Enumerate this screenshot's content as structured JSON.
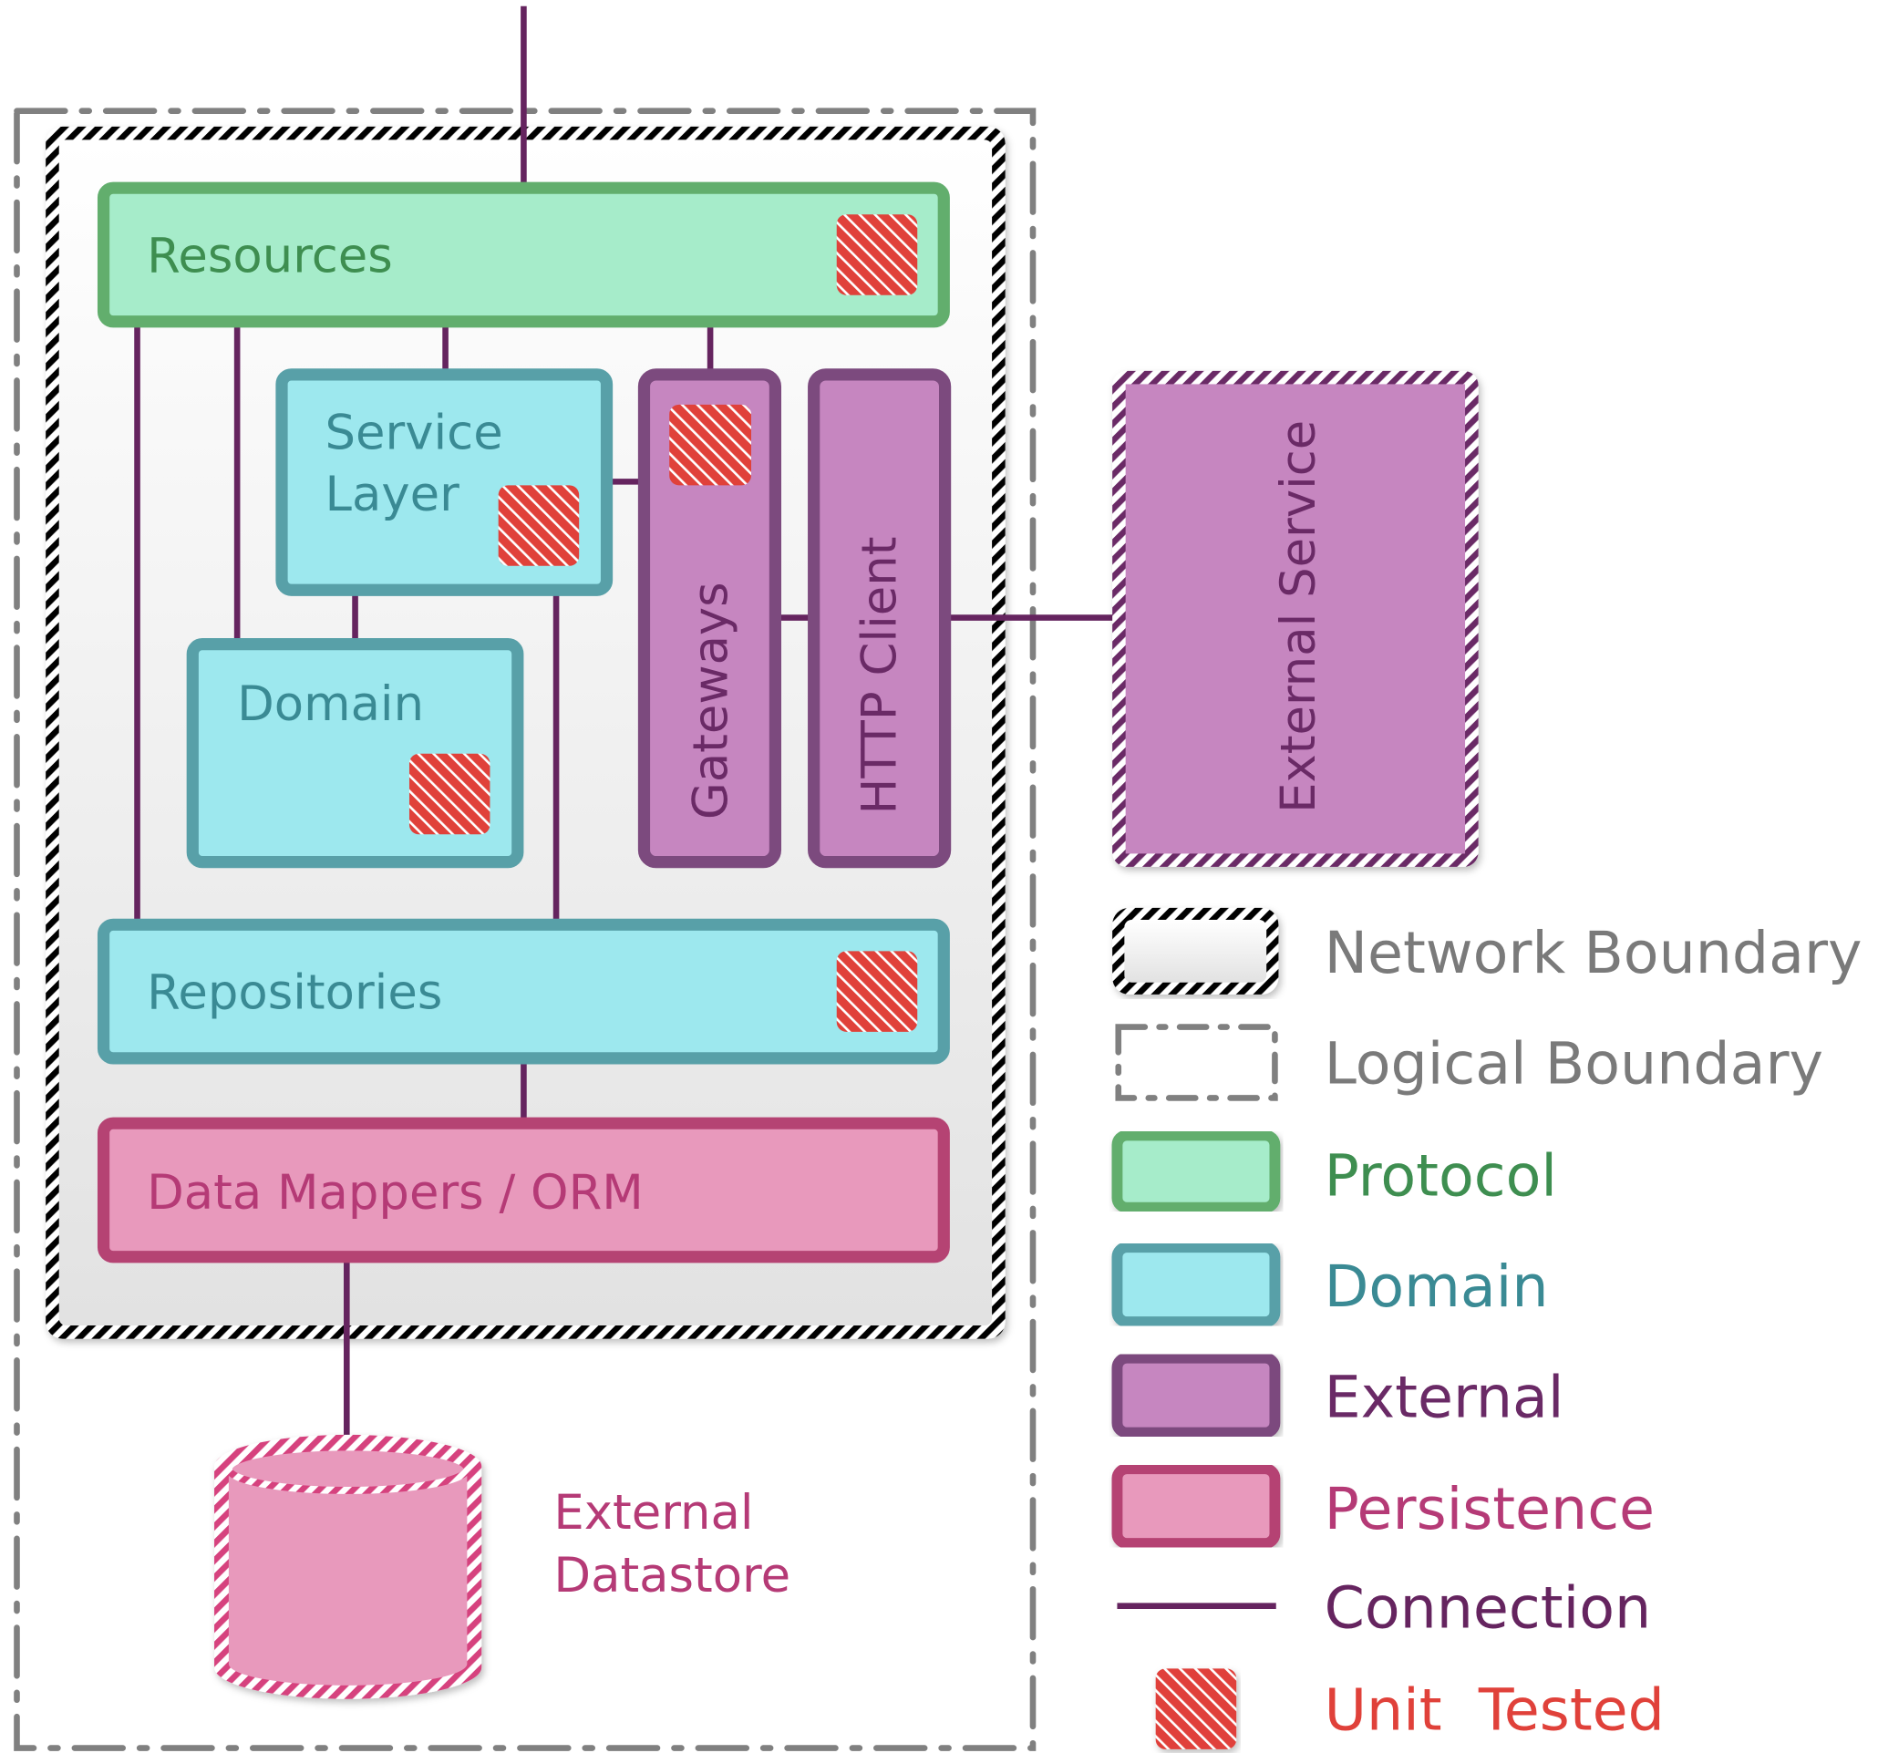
{
  "colors": {
    "protocol_fill": "#a6ecca",
    "protocol_stroke": "#62ae6d",
    "protocol_text": "#3e8e50",
    "domain_fill": "#9de8ee",
    "domain_stroke": "#58a0a8",
    "domain_text": "#3a8a94",
    "external_fill": "#c686c0",
    "external_stroke": "#7c4a7e",
    "external_text": "#6a2a66",
    "persistence_fill": "#e899bc",
    "persistence_stroke": "#b54373",
    "persistence_text": "#b53a76",
    "connection": "#65245f",
    "unit_tested": "#e0413a",
    "boundary_gray": "#808080"
  },
  "components": {
    "resources": "Resources",
    "service_layer_line1": "Service",
    "service_layer_line2": "Layer",
    "domain": "Domain",
    "gateways": "Gateways",
    "http_client": "HTTP Client",
    "external_service": "External Service",
    "repositories": "Repositories",
    "data_mappers": "Data Mappers / ORM",
    "datastore_line1": "External",
    "datastore_line2": "Datastore"
  },
  "legend": {
    "network_boundary": "Network Boundary",
    "logical_boundary": "Logical Boundary",
    "protocol": "Protocol",
    "domain": "Domain",
    "external": "External",
    "persistence": "Persistence",
    "connection": "Connection",
    "unit_tested": "Unit  Tested"
  }
}
